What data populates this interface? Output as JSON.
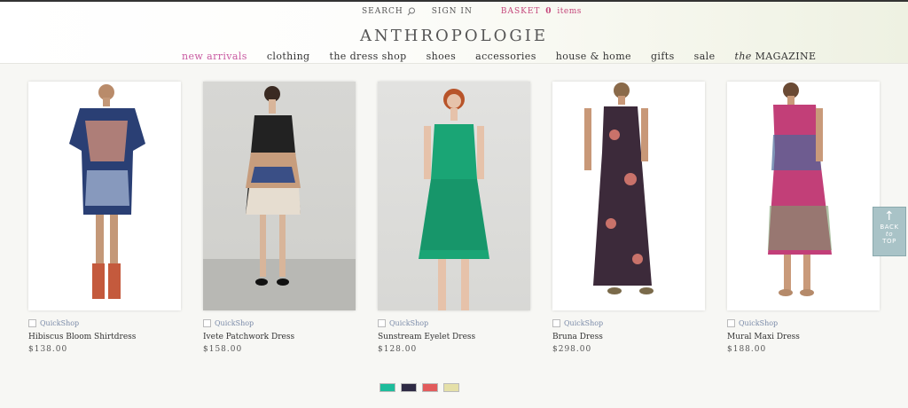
{
  "header": {
    "search_label": "SEARCH",
    "signin_label": "SIGN IN",
    "basket_label": "BASKET",
    "basket_count": "0",
    "basket_items_label": "items",
    "logo": "ANTHROPOLOGIE"
  },
  "nav": {
    "items": [
      {
        "label": "new arrivals"
      },
      {
        "label": "clothing"
      },
      {
        "label": "the dress shop"
      },
      {
        "label": "shoes"
      },
      {
        "label": "accessories"
      },
      {
        "label": "house & home"
      },
      {
        "label": "gifts"
      },
      {
        "label": "sale"
      },
      {
        "label_italic": "the",
        "label": "MAGAZINE"
      }
    ],
    "active_color": "#c95aa1"
  },
  "products": [
    {
      "quickshop": "QuickShop",
      "name": "Hibiscus Bloom Shirtdress",
      "price": "$138.00",
      "dress_colors": [
        "#2a3f74",
        "#e79a7a"
      ]
    },
    {
      "quickshop": "QuickShop",
      "name": "Ivete Patchwork Dress",
      "price": "$158.00",
      "dress_colors": [
        "#222",
        "#c79d7d"
      ]
    },
    {
      "quickshop": "QuickShop",
      "name": "Sunstream Eyelet Dress",
      "price": "$128.00",
      "dress_colors": [
        "#1aa575",
        "#14875f"
      ]
    },
    {
      "quickshop": "QuickShop",
      "name": "Bruna Dress",
      "price": "$298.00",
      "dress_colors": [
        "#3c2a3a",
        "#c9726a"
      ]
    },
    {
      "quickshop": "QuickShop",
      "name": "Mural Maxi Dress",
      "price": "$188.00",
      "dress_colors": [
        "#c23f78",
        "#4a6a9a"
      ]
    }
  ],
  "swatches": [
    "#1dbc9b",
    "#2e2a44",
    "#e25b5b",
    "#e5e0a8"
  ],
  "back_to_top": {
    "line1": "BACK",
    "line2": "to",
    "line3": "TOP"
  }
}
